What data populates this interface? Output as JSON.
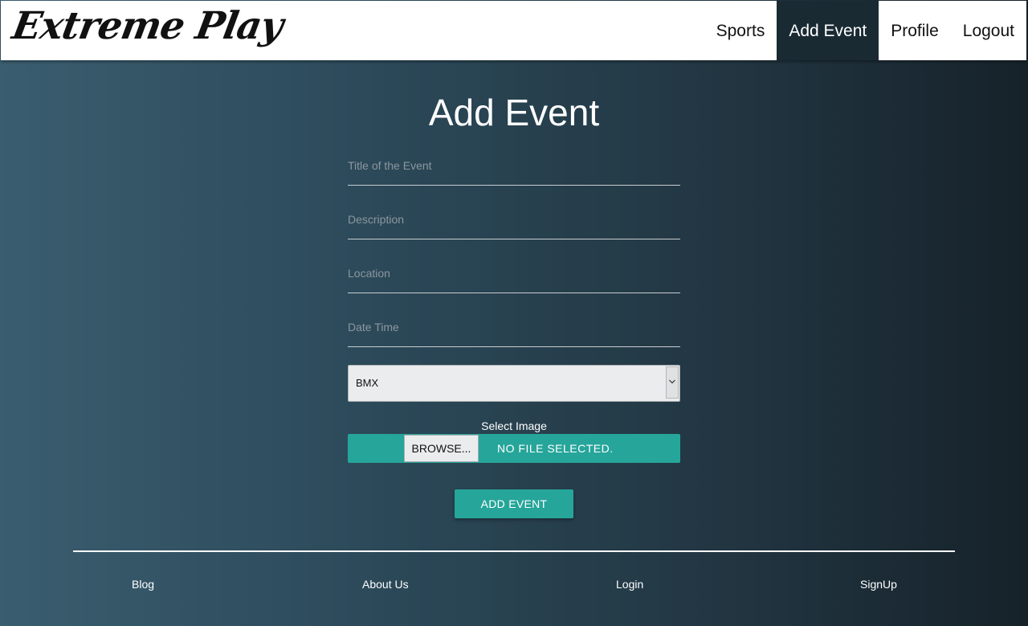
{
  "brand": {
    "logo_text": "Extreme Play"
  },
  "nav": {
    "items": [
      {
        "label": "Sports",
        "active": false
      },
      {
        "label": "Add Event",
        "active": true
      },
      {
        "label": "Profile",
        "active": false
      },
      {
        "label": "Logout",
        "active": false
      }
    ]
  },
  "page": {
    "title": "Add Event"
  },
  "form": {
    "title_placeholder": "Title of the Event",
    "description_placeholder": "Description",
    "location_placeholder": "Location",
    "datetime_placeholder": "Date Time",
    "sport_select_value": "BMX",
    "image_label": "Select Image",
    "browse_label": "BROWSE...",
    "file_status": "NO FILE SELECTED.",
    "submit_label": "ADD EVENT"
  },
  "footer": {
    "links": [
      {
        "label": "Blog"
      },
      {
        "label": "About Us"
      },
      {
        "label": "Login"
      },
      {
        "label": "SignUp"
      }
    ]
  },
  "colors": {
    "accent": "#26a59a",
    "nav_active_bg": "#1a2a33",
    "background_left": "#3a5d6f",
    "background_right": "#16222a"
  },
  "icons": {
    "select_arrow": "chevron-down-icon"
  }
}
